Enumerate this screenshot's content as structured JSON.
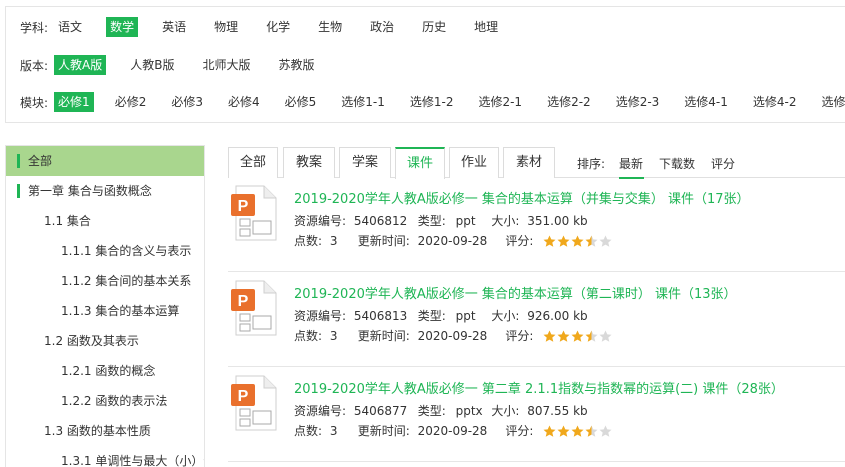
{
  "filters": {
    "subject": {
      "label": "学科:",
      "options": [
        "语文",
        "数学",
        "英语",
        "物理",
        "化学",
        "生物",
        "政治",
        "历史",
        "地理"
      ],
      "active_index": 1
    },
    "edition": {
      "label": "版本:",
      "options": [
        "人教A版",
        "人教B版",
        "北师大版",
        "苏教版"
      ],
      "active_index": 0
    },
    "module": {
      "label": "模块:",
      "options": [
        "必修1",
        "必修2",
        "必修3",
        "必修4",
        "必修5",
        "选修1-1",
        "选修1-2",
        "选修2-1",
        "选修2-2",
        "选修2-3",
        "选修4-1",
        "选修4-2",
        "选修4-4"
      ],
      "active_index": 0
    }
  },
  "sidebar": {
    "items": [
      {
        "label": "全部",
        "level": 0
      },
      {
        "label": "第一章 集合与函数概念",
        "level": 0
      },
      {
        "label": "1.1 集合",
        "level": 1
      },
      {
        "label": "1.1.1 集合的含义与表示",
        "level": 2
      },
      {
        "label": "1.1.2 集合间的基本关系",
        "level": 2
      },
      {
        "label": "1.1.3 集合的基本运算",
        "level": 2
      },
      {
        "label": "1.2 函数及其表示",
        "level": 1
      },
      {
        "label": "1.2.1 函数的概念",
        "level": 2
      },
      {
        "label": "1.2.2 函数的表示法",
        "level": 2
      },
      {
        "label": "1.3 函数的基本性质",
        "level": 1
      },
      {
        "label": "1.3.1 单调性与最大（小）值",
        "level": 2
      }
    ]
  },
  "tabs": {
    "items": [
      "全部",
      "教案",
      "学案",
      "课件",
      "作业",
      "素材"
    ],
    "active_index": 3,
    "sort_label": "排序:",
    "sort_options": [
      "最新",
      "下载数",
      "评分"
    ],
    "sort_active_index": 0
  },
  "colors": {
    "accent": "#1fb555",
    "sidebar_active_bg": "#a9d68e",
    "star": "#f0a81c",
    "ppt_orange": "#e9702c"
  },
  "resources": [
    {
      "title": "2019-2020学年人教A版必修一 集合的基本运算（并集与交集） 课件（17张）",
      "id_label": "资源编号:",
      "id": "5406812",
      "type_label": "类型:",
      "type": "ppt",
      "size_label": "大小:",
      "size": "351.00 kb",
      "points_label": "点数:",
      "points": "3",
      "updated_label": "更新时间:",
      "updated": "2020-09-28",
      "rating_label": "评分:",
      "rating": 3.5,
      "icon": "ppt-file-icon"
    },
    {
      "title": "2019-2020学年人教A版必修一 集合的基本运算（第二课时） 课件（13张）",
      "id_label": "资源编号:",
      "id": "5406813",
      "type_label": "类型:",
      "type": "ppt",
      "size_label": "大小:",
      "size": "926.00 kb",
      "points_label": "点数:",
      "points": "3",
      "updated_label": "更新时间:",
      "updated": "2020-09-28",
      "rating_label": "评分:",
      "rating": 3.5,
      "icon": "ppt-file-icon"
    },
    {
      "title": "2019-2020学年人教A版必修一 第二章 2.1.1指数与指数幂的运算(二) 课件（28张）",
      "id_label": "资源编号:",
      "id": "5406877",
      "type_label": "类型:",
      "type": "pptx",
      "size_label": "大小:",
      "size": "807.55 kb",
      "points_label": "点数:",
      "points": "3",
      "updated_label": "更新时间:",
      "updated": "2020-09-28",
      "rating_label": "评分:",
      "rating": 3.5,
      "icon": "ppt-file-icon"
    }
  ]
}
